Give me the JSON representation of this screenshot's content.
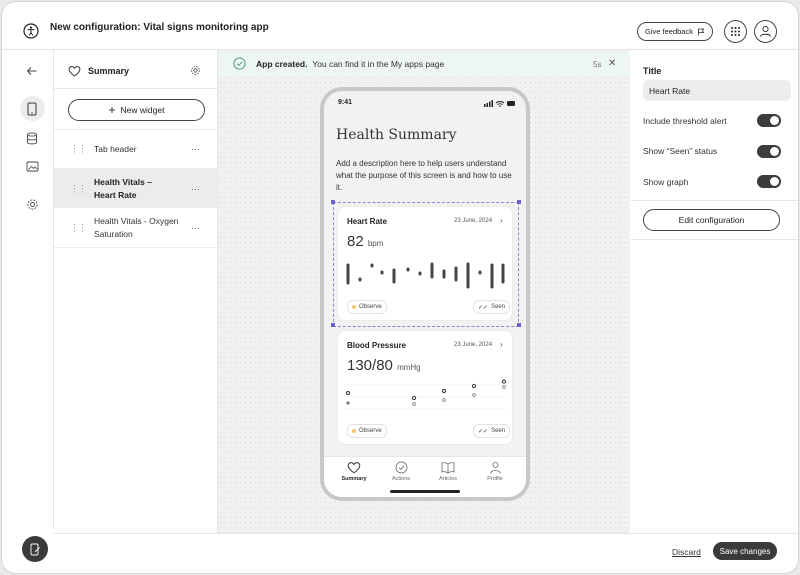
{
  "app": {
    "title": "New configuration: Vital signs monitoring app",
    "feedback_label": "Give feedback"
  },
  "icons": {
    "logo": "accessibility-logo-icon",
    "grid": "apps-grid-icon",
    "user": "user-icon",
    "back": "arrow-left-icon",
    "phone": "phone-icon",
    "database": "database-icon",
    "image": "image-icon",
    "settings": "gear-icon",
    "bottom": "phone-edit-icon",
    "heart": "heart-icon"
  },
  "left": {
    "title": "Summary",
    "new_widget_label": "New widget",
    "items": [
      {
        "label": "Tab header"
      },
      {
        "label": "Health Vitals – Heart Rate"
      },
      {
        "label": "Health Vitals - Oxygen Saturation"
      }
    ]
  },
  "toast": {
    "bold": "App created.",
    "text": "You can find it in the My apps page",
    "time": "5s"
  },
  "phone": {
    "time": "9:41",
    "title": "Health Summary",
    "description": "Add a description here to help users understand what the purpose of this screen is and how to use it.",
    "cards": [
      {
        "title": "Heart Rate",
        "date": "23 June, 2024",
        "value": "82",
        "unit": "bpm",
        "badge_observe": "Observe",
        "badge_seen": "Seen"
      },
      {
        "title": "Blood Pressure",
        "date": "23 June, 2024",
        "value": "130/80",
        "unit": "mmHg",
        "badge_observe": "Observe",
        "badge_seen": "Seen"
      }
    ],
    "nav": [
      "Summary",
      "Actions",
      "Articles",
      "Profile"
    ]
  },
  "right": {
    "title_label": "Title",
    "title_value": "Heart Rate",
    "toggles": [
      {
        "label": "Include threshold alert",
        "on": true
      },
      {
        "label": "Show “Seen” status",
        "on": true
      },
      {
        "label": "Show graph",
        "on": true
      }
    ],
    "edit_label": "Edit configuration"
  },
  "footer": {
    "discard": "Discard",
    "save": "Save changes"
  },
  "colors": {
    "accent": "#3a3a3a",
    "selection": "#6a62d0",
    "toast_bg": "#eef6f4",
    "observe_dot": "#f2c277"
  }
}
